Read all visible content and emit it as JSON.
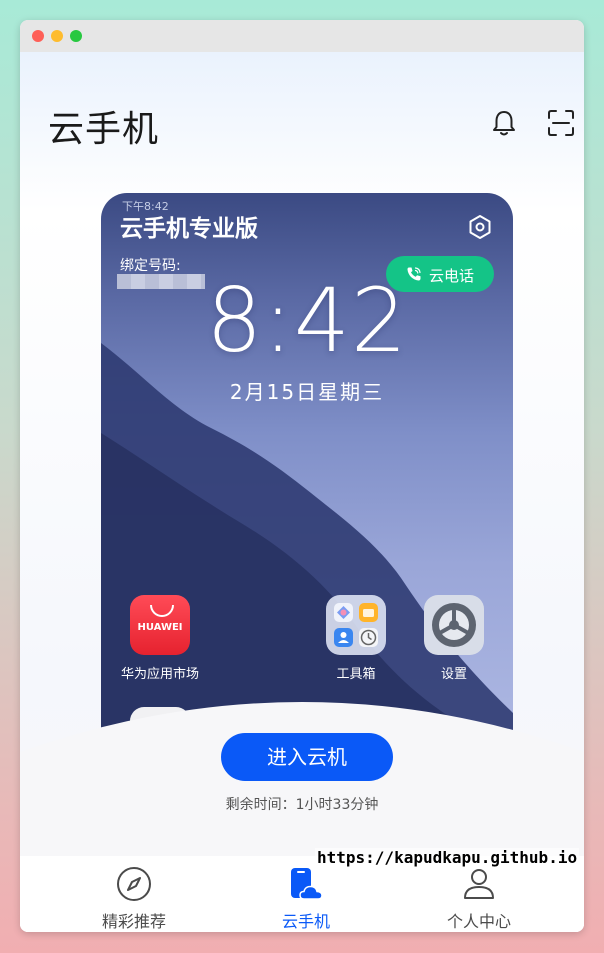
{
  "window": {
    "controls": [
      "close",
      "minimize",
      "maximize"
    ]
  },
  "header": {
    "title": "云手机",
    "icons": [
      "bell-icon",
      "scan-icon"
    ]
  },
  "phone": {
    "status_time": "下午8:42",
    "title": "云手机专业版",
    "bind_label": "绑定号码:",
    "bind_value_redacted": true,
    "call_button_label": "云电话",
    "clock": "8:42",
    "date": "2月15日星期三",
    "apps": [
      {
        "label": "华为应用市场",
        "icon_text": "HUAWEI",
        "icon": "huawei-appgallery-icon"
      },
      {
        "label": "工具箱",
        "icon": "toolbox-folder-icon"
      },
      {
        "label": "设置",
        "icon": "settings-gear-icon"
      }
    ]
  },
  "actions": {
    "enter_button": "进入云机",
    "remaining_time": "剩余时间：1小时33分钟"
  },
  "tabbar": {
    "tabs": [
      {
        "label": "精彩推荐",
        "icon": "compass-icon",
        "active": false
      },
      {
        "label": "云手机",
        "icon": "cloud-phone-icon",
        "active": true
      },
      {
        "label": "个人中心",
        "icon": "user-icon",
        "active": false
      }
    ]
  },
  "watermark": "https://kapudkapu.github.io",
  "colors": {
    "accent": "#0a59f7",
    "call_green": "#14c487"
  }
}
